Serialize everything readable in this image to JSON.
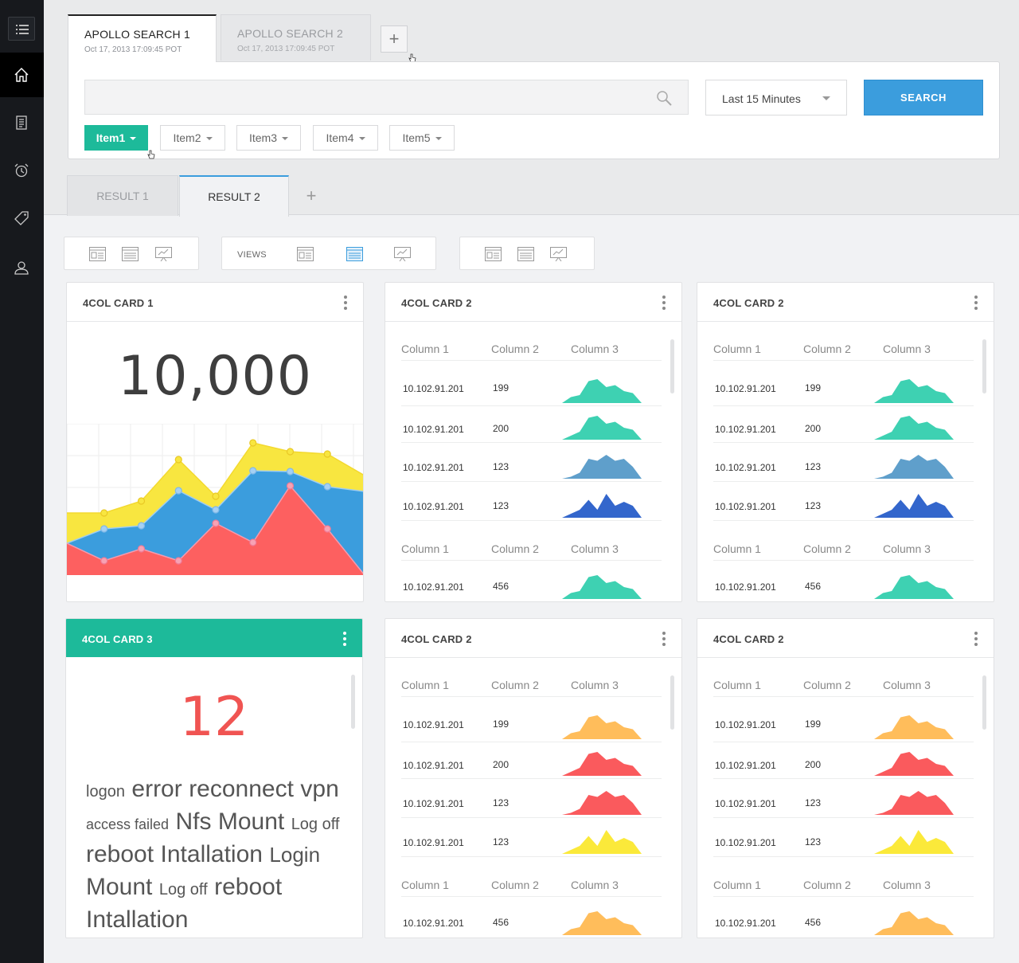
{
  "query_tabs": [
    {
      "title": "APOLLO SEARCH 1",
      "date": "Oct 17, 2013 17:09:45 POT"
    },
    {
      "title": "APOLLO SEARCH 2",
      "date": "Oct 17, 2013 17:09:45 POT"
    }
  ],
  "search": {
    "value": "",
    "placeholder": ""
  },
  "time_range": "Last 15 Minutes",
  "search_button": "SEARCH",
  "filters": [
    "Item1",
    "Item2",
    "Item3",
    "Item4",
    "Item5"
  ],
  "result_tabs": [
    "RESULT 1",
    "RESULT 2"
  ],
  "views_label": "VIEWS",
  "colors": {
    "accent_green": "#1dba9a",
    "accent_blue": "#3b9ddd",
    "chart_yellow": "#f8e640",
    "chart_blue": "#3b9ddd",
    "chart_red": "#fd6060",
    "spark_teal": "#3ed1b2",
    "spark_steel": "#5f9fcb",
    "spark_royal": "#3366cc",
    "spark_orange": "#ffbd5b",
    "spark_red": "#fa5a5d",
    "spark_yellow": "#fbe93a"
  },
  "card1": {
    "title": "4COL CARD 1",
    "big_number": "10,000",
    "chart_data": {
      "type": "area",
      "x": [
        0,
        1,
        2,
        3,
        4,
        5,
        6,
        7,
        8
      ],
      "series": [
        {
          "values": [
            0,
            0,
            0,
            0,
            0,
            0,
            0,
            0,
            0
          ]
        },
        {
          "values": [
            0,
            0,
            0,
            0,
            0,
            0,
            0,
            0,
            0
          ]
        },
        {
          "values": [
            0,
            0,
            0,
            0,
            0,
            0,
            0,
            0,
            0
          ]
        }
      ],
      "stacked_totals": [
        78,
        78,
        93,
        145,
        99,
        166,
        155,
        152,
        125
      ],
      "layer2_top": [
        40,
        58,
        62,
        106,
        82,
        131,
        130,
        111,
        105
      ],
      "layer1_top": [
        40,
        18,
        33,
        18,
        65,
        41,
        112,
        58,
        0
      ],
      "ylim": [
        0,
        190
      ]
    }
  },
  "card3": {
    "title": "4COL CARD 3",
    "count": "12",
    "words": [
      {
        "text": "logon",
        "size": 20
      },
      {
        "text": "error",
        "size": 30
      },
      {
        "text": "reconnect",
        "size": 30
      },
      {
        "text": "vpn",
        "size": 30
      },
      {
        "text": "access failed",
        "size": 18
      },
      {
        "text": "Nfs Mount",
        "size": 30
      },
      {
        "text": "Log off",
        "size": 20
      },
      {
        "text": "reboot",
        "size": 30
      },
      {
        "text": "Intallation",
        "size": 30
      },
      {
        "text": "Login",
        "size": 26
      },
      {
        "text": "Mount",
        "size": 30
      },
      {
        "text": "Log off",
        "size": 20
      },
      {
        "text": "reboot",
        "size": 30
      },
      {
        "text": "Intallation",
        "size": 30
      }
    ]
  },
  "table_cards": [
    {
      "title": "4COL CARD 2",
      "colors": [
        "teal",
        "teal",
        "steel",
        "royal",
        "teal"
      ]
    },
    {
      "title": "4COL CARD 2",
      "colors": [
        "teal",
        "teal",
        "steel",
        "royal",
        "teal"
      ]
    },
    {
      "title": "4COL CARD 2",
      "colors": [
        "orange",
        "red",
        "red",
        "yellow",
        "orange"
      ]
    },
    {
      "title": "4COL CARD 2",
      "colors": [
        "orange",
        "red",
        "red",
        "yellow",
        "orange"
      ]
    }
  ],
  "table": {
    "headers": [
      "Column 1",
      "Column 2",
      "Column 3"
    ],
    "rows1": [
      {
        "ip": "10.102.91.201",
        "val": "199"
      },
      {
        "ip": "10.102.91.201",
        "val": "200"
      },
      {
        "ip": "10.102.91.201",
        "val": "123"
      },
      {
        "ip": "10.102.91.201",
        "val": "123"
      }
    ],
    "rows2": [
      {
        "ip": "10.102.91.201",
        "val": "456"
      }
    ],
    "spark_values": [
      [
        0,
        3,
        4,
        11,
        12,
        8,
        9,
        6,
        5,
        0
      ],
      [
        0,
        2,
        4,
        11,
        12,
        8,
        9,
        6,
        5,
        0
      ],
      [
        0,
        1,
        3,
        10,
        9,
        12,
        9,
        10,
        6,
        0
      ],
      [
        0,
        2,
        4,
        9,
        4,
        12,
        6,
        8,
        6,
        0
      ],
      [
        0,
        3,
        4,
        11,
        12,
        8,
        9,
        6,
        5,
        0
      ]
    ]
  }
}
